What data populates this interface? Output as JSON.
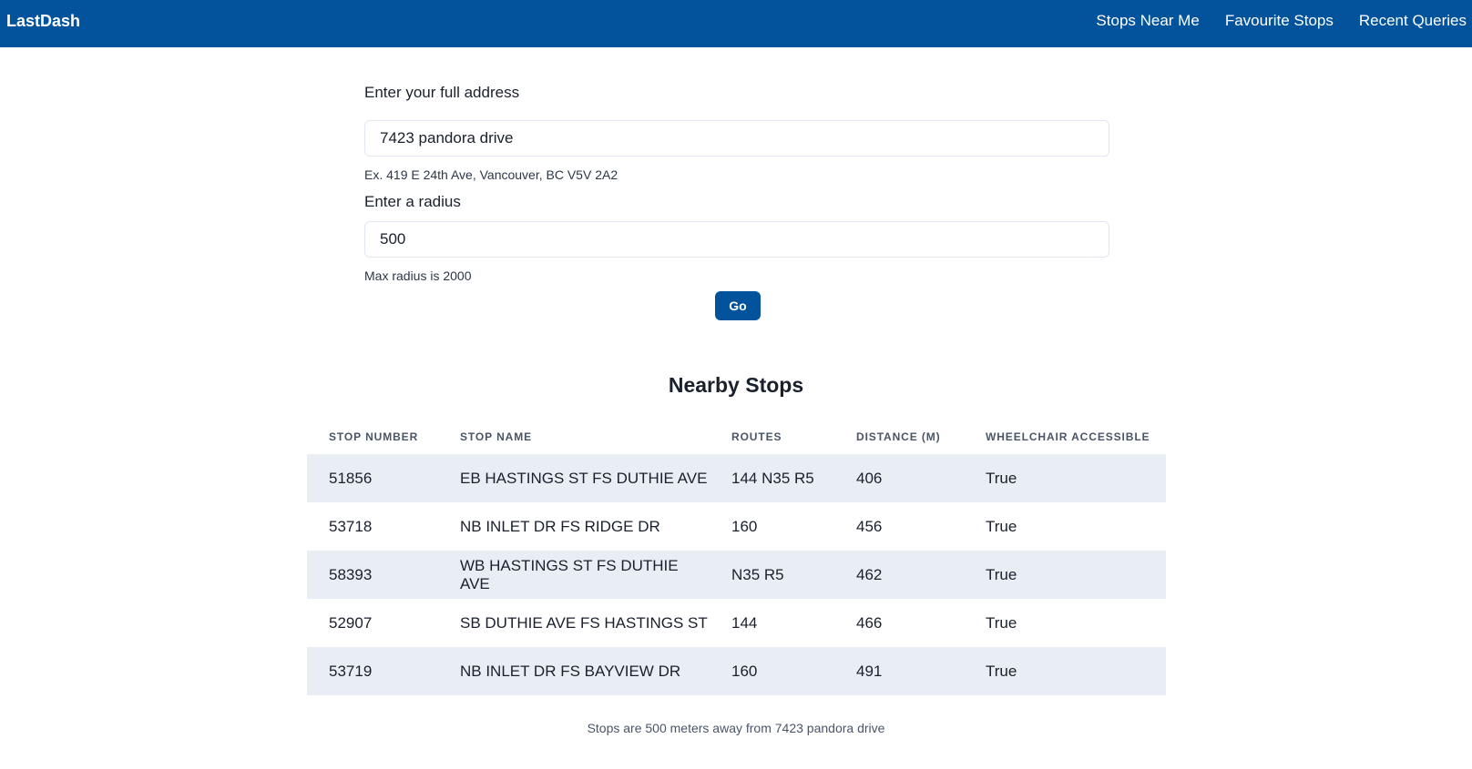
{
  "navbar": {
    "brand": "LastDash",
    "links": [
      "Stops Near Me",
      "Favourite Stops",
      "Recent Queries"
    ],
    "background": "#02529c"
  },
  "form": {
    "address_label": "Enter your full address",
    "address_value": "7423 pandora drive",
    "address_helper": "Ex. 419 E 24th Ave, Vancouver, BC V5V 2A2",
    "radius_label": "Enter a radius",
    "radius_value": "500",
    "radius_helper": "Max radius is 2000",
    "go_label": "Go"
  },
  "results": {
    "title": "Nearby Stops",
    "columns": [
      "Stop Number",
      "Stop Name",
      "Routes",
      "Distance (m)",
      "Wheelchair Accessible"
    ],
    "rows": [
      [
        "51856",
        "EB HASTINGS ST FS DUTHIE AVE",
        "144 N35 R5",
        "406",
        "True"
      ],
      [
        "53718",
        "NB INLET DR FS RIDGE DR",
        "160",
        "456",
        "True"
      ],
      [
        "58393",
        "WB HASTINGS ST FS DUTHIE AVE",
        "N35 R5",
        "462",
        "True"
      ],
      [
        "52907",
        "SB DUTHIE AVE FS HASTINGS ST",
        "144",
        "466",
        "True"
      ],
      [
        "53719",
        "NB INLET DR FS BAYVIEW DR",
        "160",
        "491",
        "True"
      ]
    ],
    "caption": "Stops are 500 meters away from 7423 pandora drive"
  }
}
